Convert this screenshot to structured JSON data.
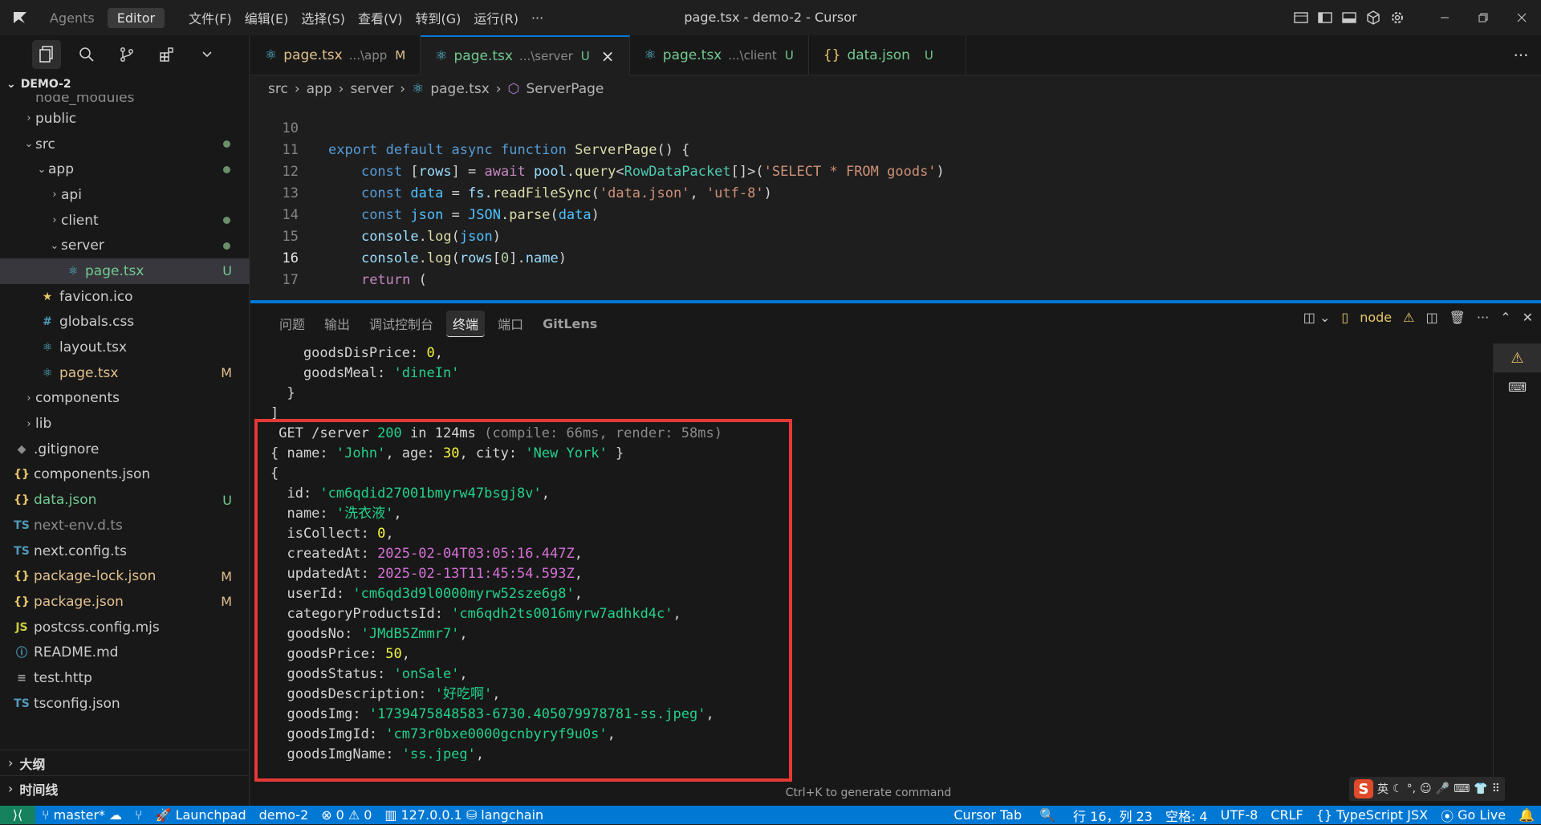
{
  "titlebar": {
    "tabs": [
      "Agents",
      "Editor"
    ],
    "menus": [
      "文件(F)",
      "编辑(E)",
      "选择(S)",
      "查看(V)",
      "转到(G)",
      "运行(R)"
    ],
    "more": "···",
    "title": "page.tsx - demo-2 - Cursor"
  },
  "explorer": {
    "project": "DEMO-2",
    "items": [
      {
        "label": "node_modules",
        "type": "folder",
        "icon": "",
        "chev": "",
        "status": ""
      },
      {
        "label": "public",
        "type": "folder",
        "icon": "",
        "chev": "›",
        "status": ""
      },
      {
        "label": "src",
        "type": "folder",
        "icon": "",
        "chev": "⌄",
        "status": ""
      },
      {
        "label": "app",
        "type": "folder",
        "icon": "",
        "chev": "⌄",
        "status": ""
      },
      {
        "label": "api",
        "type": "folder",
        "icon": "",
        "chev": "›",
        "status": ""
      },
      {
        "label": "client",
        "type": "folder",
        "icon": "",
        "chev": "›",
        "status": ""
      },
      {
        "label": "server",
        "type": "folder",
        "icon": "",
        "chev": "⌄",
        "status": ""
      },
      {
        "label": "page.tsx",
        "type": "file",
        "icon": "⚛",
        "chev": "",
        "status": "U"
      },
      {
        "label": "favicon.ico",
        "type": "file",
        "icon": "★",
        "chev": "",
        "status": ""
      },
      {
        "label": "globals.css",
        "type": "file",
        "icon": "#",
        "chev": "",
        "status": ""
      },
      {
        "label": "layout.tsx",
        "type": "file",
        "icon": "⚛",
        "chev": "",
        "status": ""
      },
      {
        "label": "page.tsx",
        "type": "file",
        "icon": "⚛",
        "chev": "",
        "status": "M"
      },
      {
        "label": "components",
        "type": "folder",
        "icon": "",
        "chev": "›",
        "status": ""
      },
      {
        "label": "lib",
        "type": "folder",
        "icon": "",
        "chev": "›",
        "status": ""
      },
      {
        "label": ".gitignore",
        "type": "file",
        "icon": "◆",
        "chev": "",
        "status": ""
      },
      {
        "label": "components.json",
        "type": "file",
        "icon": "{}",
        "chev": "",
        "status": ""
      },
      {
        "label": "data.json",
        "type": "file",
        "icon": "{}",
        "chev": "",
        "status": "U"
      },
      {
        "label": "next-env.d.ts",
        "type": "file",
        "icon": "TS",
        "chev": "",
        "status": ""
      },
      {
        "label": "next.config.ts",
        "type": "file",
        "icon": "TS",
        "chev": "",
        "status": ""
      },
      {
        "label": "package-lock.json",
        "type": "file",
        "icon": "{}",
        "chev": "",
        "status": "M"
      },
      {
        "label": "package.json",
        "type": "file",
        "icon": "{}",
        "chev": "",
        "status": "M"
      },
      {
        "label": "postcss.config.mjs",
        "type": "file",
        "icon": "JS",
        "chev": "",
        "status": ""
      },
      {
        "label": "README.md",
        "type": "file",
        "icon": "ⓘ",
        "chev": "",
        "status": ""
      },
      {
        "label": "test.http",
        "type": "file",
        "icon": "≡",
        "chev": "",
        "status": ""
      },
      {
        "label": "tsconfig.json",
        "type": "file",
        "icon": "TS",
        "chev": "",
        "status": ""
      }
    ],
    "outline": "大纲",
    "timeline": "时间线"
  },
  "editor": {
    "tabs": [
      {
        "name": "page.tsx",
        "desc": "...\\app",
        "status": "M"
      },
      {
        "name": "page.tsx",
        "desc": "...\\server",
        "status": "U"
      },
      {
        "name": "page.tsx",
        "desc": "...\\client",
        "status": "U"
      },
      {
        "name": "data.json",
        "desc": "",
        "status": "U"
      }
    ],
    "more": "···",
    "breadcrumb": [
      "src",
      "app",
      "server",
      "page.tsx",
      "ServerPage"
    ],
    "line_numbers": [
      "10",
      "11",
      "12",
      "13",
      "14",
      "15",
      "16",
      "17"
    ]
  },
  "panel": {
    "tabs": [
      "问题",
      "输出",
      "调试控制台",
      "终端",
      "端口",
      "GitLens"
    ],
    "terminal_name": "node",
    "hint": "Ctrl+K to generate command",
    "ime": [
      "英",
      "☾",
      "°,",
      "☺",
      "🎤",
      "⌨",
      "👕",
      "⠿"
    ]
  },
  "statusbar": {
    "branch": "master*",
    "launchpad": "Launchpad",
    "project": "demo-2",
    "errors": "0",
    "warnings": "0",
    "host": "127.0.0.1",
    "db": "langchain",
    "cursor_tab": "Cursor Tab",
    "position": "行 16，列 23",
    "spaces": "空格: 4",
    "encoding": "UTF-8",
    "eol": "CRLF",
    "language": "TypeScript JSX",
    "golive": "Go Live"
  },
  "colors": {
    "accent": "#0078d4",
    "highlight_box": "#e53935",
    "status_remote": "#16825d"
  }
}
